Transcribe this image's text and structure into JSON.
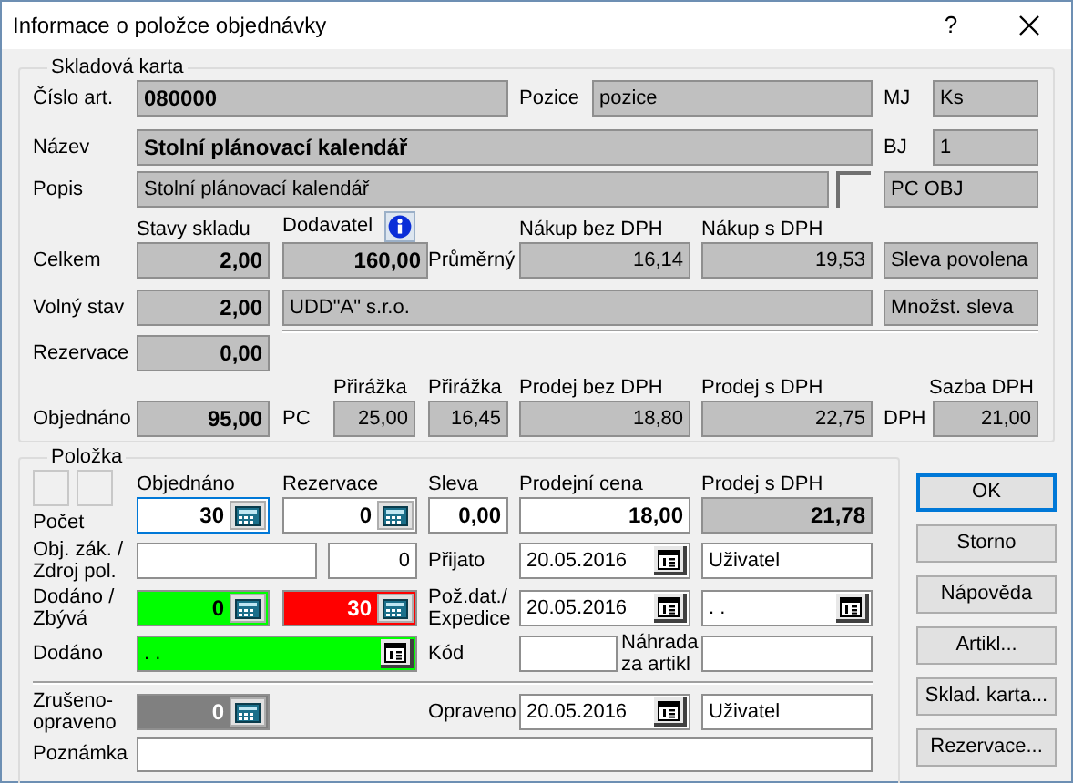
{
  "window": {
    "title": "Informace o položce objednávky",
    "help": "?"
  },
  "stock_card": {
    "legend": "Skladová karta",
    "article_no": {
      "label": "Číslo art.",
      "value": "080000",
      "read_only": true
    },
    "position": {
      "label": "Pozice",
      "value": "pozice",
      "read_only": true
    },
    "unit": {
      "label": "MJ",
      "value": "Ks",
      "read_only": true
    },
    "name": {
      "label": "Název",
      "value": "Stolní plánovací kalendář",
      "read_only": true
    },
    "base_unit": {
      "label": "BJ",
      "value": "1",
      "read_only": true
    },
    "description": {
      "label": "Popis",
      "value": "Stolní plánovací kalendář",
      "read_only": true
    },
    "price_list": {
      "value": "PC OBJ",
      "read_only": true
    },
    "headers": [
      "Stavy skladu",
      "Dodavatel",
      "Nákup bez DPH",
      "Nákup s DPH"
    ],
    "total": {
      "label": "Celkem",
      "value": "2,00",
      "read_only": true
    },
    "supplier_qty": {
      "value": "160,00",
      "read_only": true
    },
    "average_label": "Průměrný",
    "purchase_net": {
      "value": "16,14",
      "read_only": true
    },
    "purchase_gross": {
      "value": "19,53",
      "read_only": true
    },
    "discount_allowed": {
      "value": "Sleva povolena",
      "read_only": true
    },
    "free": {
      "label": "Volný stav",
      "value": "2,00",
      "read_only": true
    },
    "supplier_name": {
      "value": "UDD\"A\" s.r.o.",
      "read_only": true
    },
    "quantity_discount": {
      "value": "Množst. sleva",
      "read_only": true
    },
    "reserved": {
      "label": "Rezervace",
      "value": "0,00",
      "read_only": true
    },
    "sale_headers": [
      "Přirážka",
      "Přirážka",
      "Prodej bez DPH",
      "Prodej s DPH",
      "Sazba DPH"
    ],
    "ordered": {
      "label": "Objednáno",
      "value": "95,00",
      "read_only": true
    },
    "pc_label": "PC",
    "markup_1": {
      "value": "25,00",
      "read_only": true
    },
    "markup_2": {
      "value": "16,45",
      "read_only": true
    },
    "sale_net": {
      "value": "18,80",
      "read_only": true
    },
    "sale_gross": {
      "value": "22,75",
      "read_only": true
    },
    "vat_label": "DPH",
    "vat_rate": {
      "value": "21,00",
      "read_only": true
    }
  },
  "item": {
    "legend": "Položka",
    "headers": [
      "Objednáno",
      "Rezervace",
      "Sleva",
      "Prodejní cena",
      "Prodej s DPH"
    ],
    "count_label": "Počet",
    "ordered": {
      "value": "30",
      "read_only": false,
      "focused": true
    },
    "reserved": {
      "value": "0",
      "read_only": false,
      "focused": false
    },
    "discount": {
      "value": "0,00",
      "read_only": false
    },
    "sale_price": {
      "value": "18,00",
      "read_only": false
    },
    "sale_gross": {
      "value": "21,78",
      "read_only": true
    },
    "customer_order_label": [
      "Obj. zák. /",
      "Zdroj pol."
    ],
    "customer_order": {
      "read_only": false
    },
    "source": {
      "value": "0",
      "read_only": false
    },
    "received_label": "Přijato",
    "received_date": {
      "value": "20.05.2016",
      "read_only": false
    },
    "received_user": {
      "value": "Uživatel",
      "read_only": false
    },
    "delivered_label": [
      "Dodáno /",
      "Zbývá"
    ],
    "delivered": {
      "value": "0",
      "complete": true
    },
    "remaining": {
      "value": "30",
      "shortfall": true
    },
    "requested_label": [
      "Pož.dat./",
      "Expedice"
    ],
    "requested_date": {
      "value": "20.05.2016",
      "read_only": false
    },
    "dispatch_date": {
      "value": ". .",
      "read_only": false
    },
    "delivery_label": "Dodáno",
    "delivery_date": {
      "value": ". .",
      "complete": true
    },
    "code_label": "Kód",
    "code": {
      "read_only": false
    },
    "replacement_label": [
      "Náhrada",
      "za artikl"
    ],
    "replacement": {
      "read_only": false
    },
    "cancelled_label": [
      "Zrušeno-",
      "opraveno"
    ],
    "cancelled": {
      "value": "0",
      "disabled": true
    },
    "corrected_label": "Opraveno",
    "corrected_date": {
      "value": "20.05.2016",
      "read_only": false
    },
    "corrected_user": {
      "value": "Uživatel",
      "read_only": false
    },
    "note_label": "Poznámka",
    "note": {
      "read_only": false
    }
  },
  "buttons": [
    {
      "label": "OK",
      "default": true
    },
    {
      "label": "Storno",
      "default": false
    },
    {
      "label": "Nápověda",
      "default": false
    },
    {
      "label": "Artikl...",
      "default": false
    },
    {
      "label": "Sklad. karta...",
      "default": false
    },
    {
      "label": "Rezervace...",
      "default": false
    }
  ]
}
